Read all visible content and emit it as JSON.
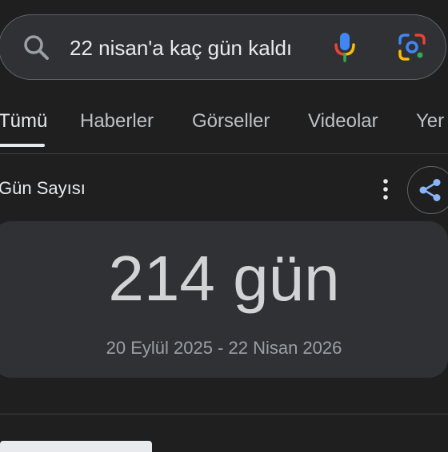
{
  "search": {
    "query": "22 nisan'a kaç gün kaldı"
  },
  "tabs": [
    {
      "label": "Tümü",
      "active": true
    },
    {
      "label": "Haberler",
      "active": false
    },
    {
      "label": "Görseller",
      "active": false
    },
    {
      "label": "Videolar",
      "active": false
    },
    {
      "label": "Yer",
      "active": false
    }
  ],
  "result": {
    "section_title": "Gün Sayısı",
    "value": "214 gün",
    "range": "20 Eylül 2025 - 22 Nisan 2026"
  },
  "colors": {
    "background": "#1f1f1f",
    "surface": "#303134",
    "mic_blue": "#4285f4",
    "mic_red": "#ea4335",
    "mic_yellow": "#fbbc05",
    "mic_green": "#34a853",
    "share_icon": "#8ab4f8"
  },
  "icons": {
    "search": "search-icon",
    "mic": "mic-icon",
    "lens": "lens-icon",
    "more": "more-vert-icon",
    "share": "share-icon"
  }
}
